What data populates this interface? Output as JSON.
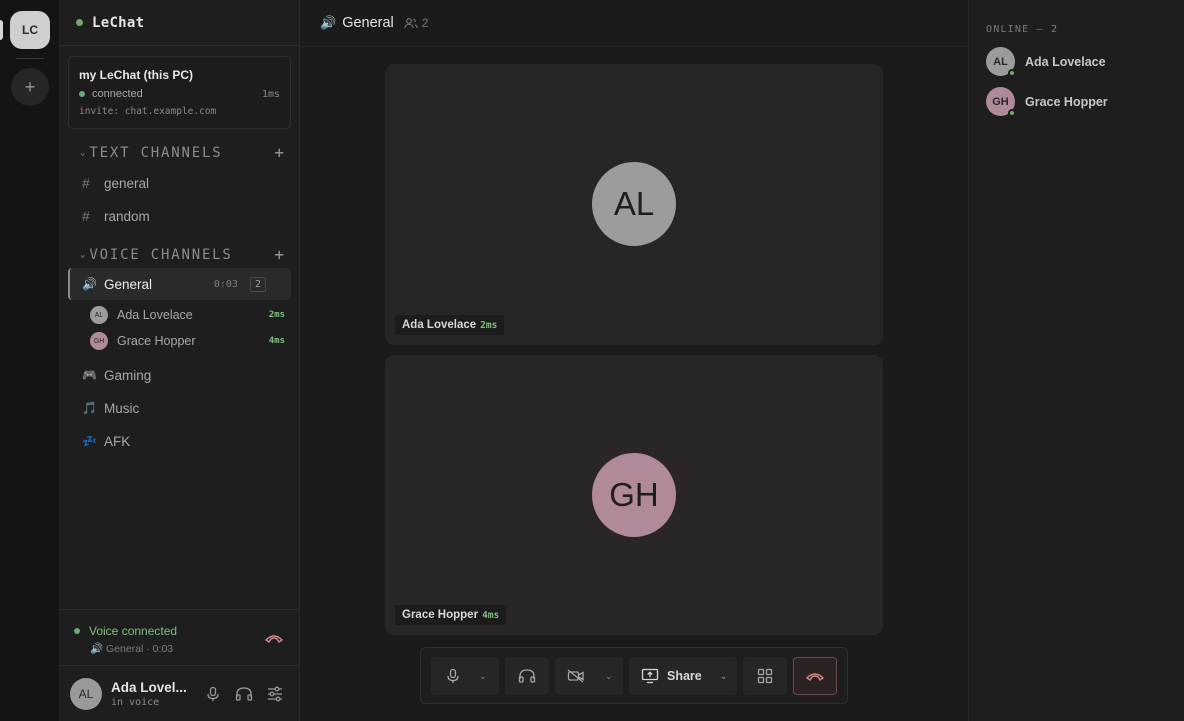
{
  "rail": {
    "server_initials": "LC",
    "add_label": "+"
  },
  "server": {
    "name": "LeChat",
    "host": {
      "title": "my LeChat (this PC)",
      "status": "connected",
      "latency": "1ms",
      "invite": "invite: chat.example.com"
    }
  },
  "text_section": {
    "label": "TEXT CHANNELS",
    "channels": [
      {
        "name": "general"
      },
      {
        "name": "random"
      }
    ]
  },
  "voice_section": {
    "label": "VOICE CHANNELS",
    "active": {
      "name": "General",
      "time": "0:03",
      "count": "2",
      "users": [
        {
          "initials": "AL",
          "name": "Ada Lovelace",
          "ping": "2ms",
          "color": "#9c9c9c"
        },
        {
          "initials": "GH",
          "name": "Grace Hopper",
          "ping": "4ms",
          "color": "#b0899a"
        }
      ]
    },
    "others": [
      {
        "name": "Gaming",
        "icon": "gamepad-icon"
      },
      {
        "name": "Music",
        "icon": "music-note-icon"
      },
      {
        "name": "AFK",
        "icon": "sleep-icon"
      }
    ]
  },
  "voice_status": {
    "label": "Voice connected",
    "detail": "General · 0:03"
  },
  "user": {
    "initials": "AL",
    "name": "Ada Lovel...",
    "status": "in voice"
  },
  "main": {
    "channel": "General",
    "participant_count": "2",
    "tiles": [
      {
        "initials": "AL",
        "name": "Ada Lovelace",
        "ping": "2ms"
      },
      {
        "initials": "GH",
        "name": "Grace Hopper",
        "ping": "4ms"
      }
    ],
    "controls": {
      "share_label": "Share"
    }
  },
  "members": {
    "header": "ONLINE — 2",
    "list": [
      {
        "initials": "AL",
        "name": "Ada Lovelace",
        "color": "#9c9c9c"
      },
      {
        "initials": "GH",
        "name": "Grace Hopper",
        "color": "#b0899a"
      }
    ]
  },
  "colors": {
    "online": "#6fa86f",
    "ping": "#7fbf7f",
    "hangup": "#d38a8a"
  }
}
